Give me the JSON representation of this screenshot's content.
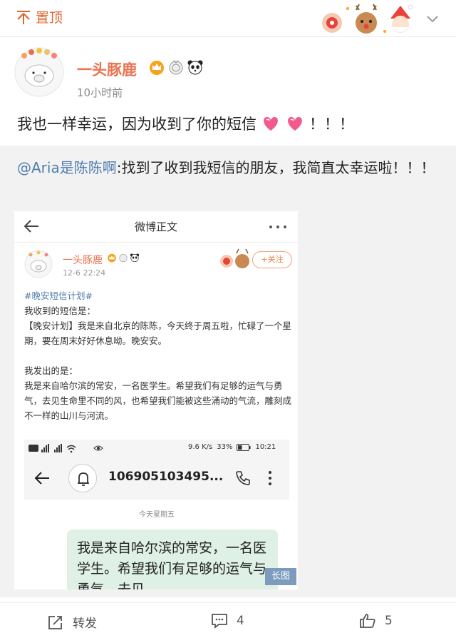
{
  "header": {
    "pin_label": "置顶",
    "pin_icon": "pin-top-icon",
    "collapse_icon": "chevron-down-icon"
  },
  "post": {
    "author": "一头豚鹿",
    "time": "10小时前",
    "text": "我也一样幸运，因为收到了你的短信",
    "text_tail": "！！！",
    "emoji": "heart-emoji",
    "accent_color": "#eb7350"
  },
  "repost": {
    "mention": "@Aria是陈陈啊",
    "text": ":找到了收到我短信的朋友，我简直太幸运啦！！！",
    "mention_color": "#507daf",
    "embedded": {
      "page_title": "微博正文",
      "author": "一头豚鹿",
      "time": "12-6 22:24",
      "follow_label": "+关注",
      "hashtag": "#晚安短信计划#",
      "body_lines": [
        "我收到的短信是：",
        "【晚安计划】我是来自北京的陈陈，今天终于周五啦，忙碌了一个星期，要在周末好好休息呦。晚安安。",
        "",
        "我发出的是：",
        "我是来自哈尔滨的常安，一名医学生。希望我们有足够的运气与勇气，去见生命里不同的风，也希望我们能被这些涌动的气流，雕刻成不一样的山川与河流。"
      ],
      "phone": {
        "status_speed": "9.6 K/s",
        "battery": "33%",
        "clock": "10:21",
        "sender": "106905103495...",
        "day": "今天星期五",
        "message": "我是来自哈尔滨的常安，一名医学生。希望我们有足够的运气与勇气，去见"
      },
      "long_image_label": "长图"
    }
  },
  "footer": {
    "repost_label": "转发",
    "comment_count": "4",
    "like_count": "5"
  }
}
